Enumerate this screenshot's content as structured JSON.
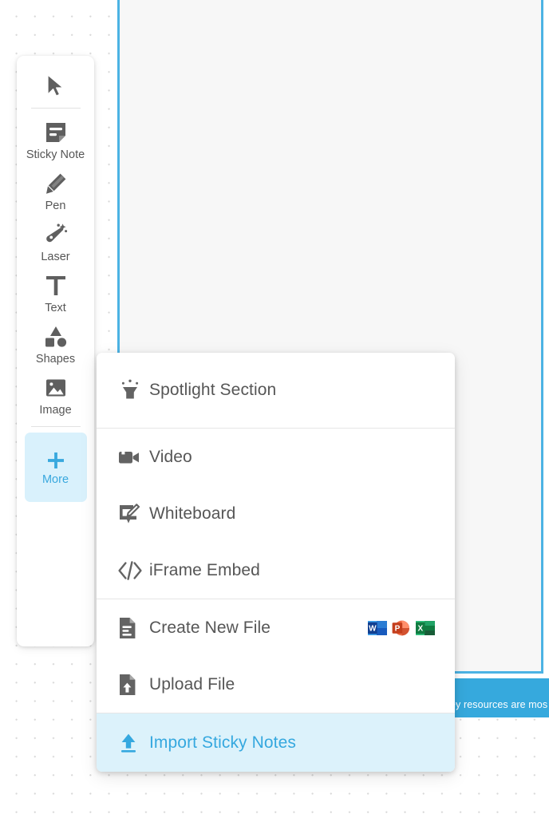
{
  "app": {
    "accent_color": "#35a8df",
    "highlight_bg": "#dcf2fb",
    "icon_gray": "#5f5f5f"
  },
  "canvas": {
    "frame_border_color": "#4cb3e4",
    "frame_fill": "#f7f7f7",
    "sticky_note": {
      "text": "ey resources are mos",
      "color": "#36a9dd"
    }
  },
  "toolbar": {
    "items": [
      {
        "label": "",
        "icon": "cursor-icon",
        "name": "select",
        "active": false
      },
      {
        "label": "Sticky Note",
        "icon": "sticky-note-icon",
        "name": "sticky-note",
        "active": false
      },
      {
        "label": "Pen",
        "icon": "pen-icon",
        "name": "pen",
        "active": false
      },
      {
        "label": "Laser",
        "icon": "laser-icon",
        "name": "laser",
        "active": false
      },
      {
        "label": "Text",
        "icon": "text-icon",
        "name": "text",
        "active": false
      },
      {
        "label": "Shapes",
        "icon": "shapes-icon",
        "name": "shapes",
        "active": false
      },
      {
        "label": "Image",
        "icon": "image-icon",
        "name": "image",
        "active": false
      },
      {
        "label": "More",
        "icon": "plus-icon",
        "name": "more",
        "active": true
      }
    ]
  },
  "more_menu": {
    "groups": [
      {
        "items": [
          {
            "label": "Spotlight Section",
            "icon": "spotlight-icon",
            "name": "spotlight-section",
            "highlighted": false
          }
        ]
      },
      {
        "items": [
          {
            "label": "Video",
            "icon": "video-icon",
            "name": "video",
            "highlighted": false
          },
          {
            "label": "Whiteboard",
            "icon": "whiteboard-icon",
            "name": "whiteboard",
            "highlighted": false
          },
          {
            "label": "iFrame Embed",
            "icon": "code-icon",
            "name": "iframe-embed",
            "highlighted": false
          }
        ]
      },
      {
        "items": [
          {
            "label": "Create New File",
            "icon": "file-lines-icon",
            "name": "create-new-file",
            "highlighted": false,
            "office": [
              {
                "name": "word-icon",
                "letter": "W",
                "color": "#2b579a"
              },
              {
                "name": "powerpoint-icon",
                "letter": "P",
                "color": "#d24726"
              },
              {
                "name": "excel-icon",
                "letter": "X",
                "color": "#217346"
              }
            ]
          },
          {
            "label": "Upload File",
            "icon": "file-upload-icon",
            "name": "upload-file",
            "highlighted": false
          }
        ]
      },
      {
        "items": [
          {
            "label": "Import Sticky Notes",
            "icon": "upload-arrow-icon",
            "name": "import-sticky-notes",
            "highlighted": true
          }
        ]
      }
    ]
  }
}
